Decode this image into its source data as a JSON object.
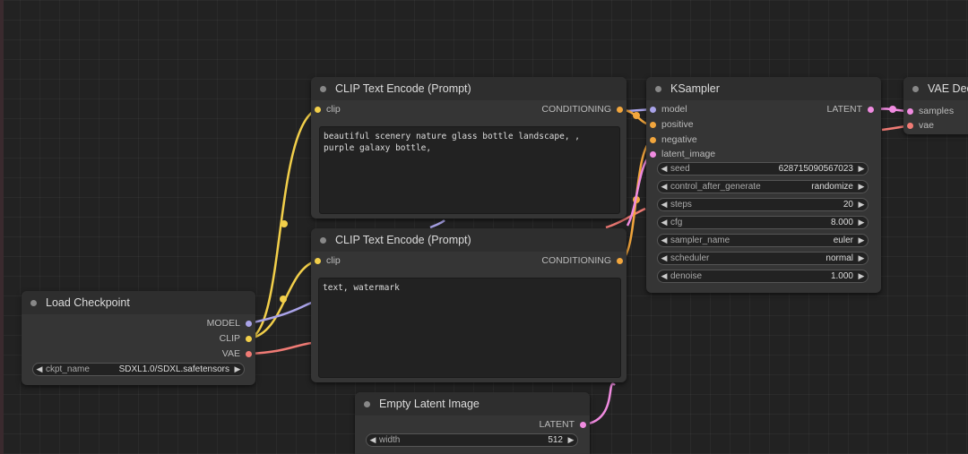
{
  "colors": {
    "model": "#a9a3e8",
    "clip": "#f2cf4a",
    "vae": "#f07b75",
    "conditioning": "#f2a63d",
    "latent": "#f08be0"
  },
  "nodes": {
    "clip_positive": {
      "title": "CLIP Text Encode (Prompt)",
      "input_clip": "clip",
      "output": "CONDITIONING",
      "text": "beautiful scenery nature glass bottle landscape, , \npurple galaxy bottle,"
    },
    "clip_negative": {
      "title": "CLIP Text Encode (Prompt)",
      "input_clip": "clip",
      "output": "CONDITIONING",
      "text": "text, watermark"
    },
    "ksampler": {
      "title": "KSampler",
      "inputs": [
        "model",
        "positive",
        "negative",
        "latent_image"
      ],
      "output": "LATENT",
      "widgets": [
        {
          "name": "seed",
          "value": "628715090567023"
        },
        {
          "name": "control_after_generate",
          "value": "randomize"
        },
        {
          "name": "steps",
          "value": "20"
        },
        {
          "name": "cfg",
          "value": "8.000"
        },
        {
          "name": "sampler_name",
          "value": "euler"
        },
        {
          "name": "scheduler",
          "value": "normal"
        },
        {
          "name": "denoise",
          "value": "1.000"
        }
      ]
    },
    "vae_decode": {
      "title": "VAE Dec",
      "inputs": [
        "samples",
        "vae"
      ]
    },
    "load_checkpoint": {
      "title": "Load Checkpoint",
      "outputs": [
        "MODEL",
        "CLIP",
        "VAE"
      ],
      "widget": {
        "name": "ckpt_name",
        "value": "SDXL1.0/SDXL.safetensors"
      }
    },
    "empty_latent": {
      "title": "Empty Latent Image",
      "output": "LATENT",
      "widget": {
        "name": "width",
        "value": "512"
      }
    }
  }
}
